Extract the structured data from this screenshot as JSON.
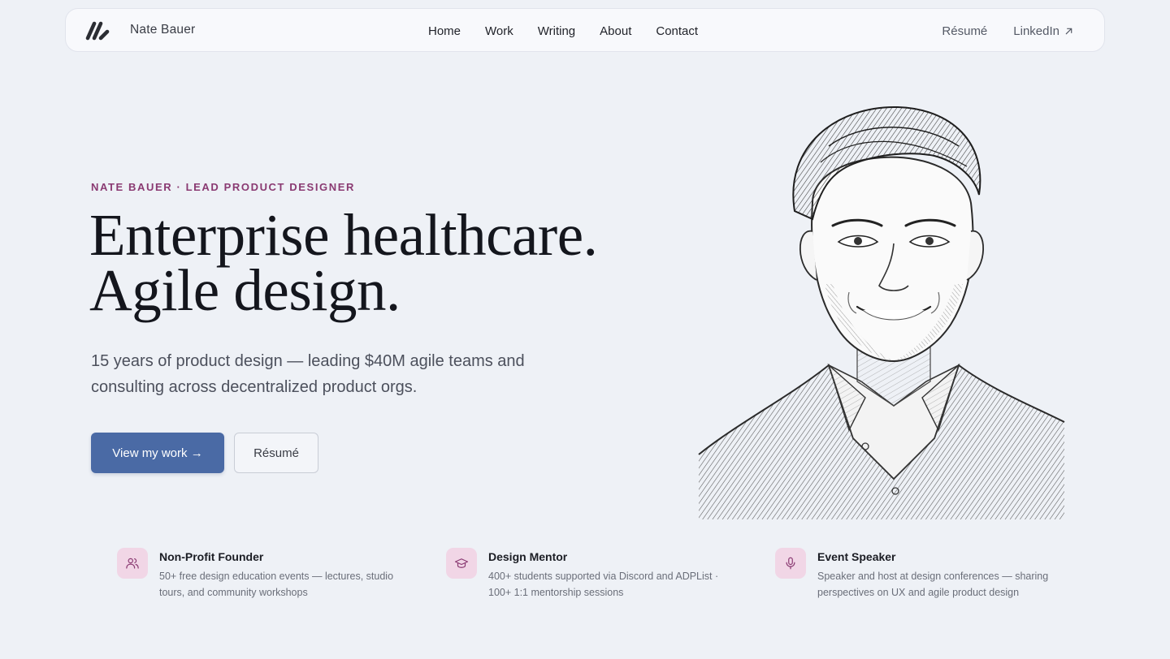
{
  "nav": {
    "brand_name": "Nate Bauer",
    "links": [
      "Home",
      "Work",
      "Writing",
      "About",
      "Contact"
    ],
    "resume": "Résumé",
    "linkedin": "LinkedIn"
  },
  "hero": {
    "eyebrow": "NATE BAUER · LEAD PRODUCT DESIGNER",
    "headline_line1": "Enterprise healthcare.",
    "headline_line2": "Agile design.",
    "lead": "15 years of product design — leading $40M agile teams and consulting across decentralized product orgs.",
    "primary_cta": "View my work →",
    "secondary_cta": "Résumé"
  },
  "features": [
    {
      "icon": "users-icon",
      "title": "Non-Profit Founder",
      "desc": "50+ free design education events — lectures, studio tours, and community workshops"
    },
    {
      "icon": "graduation-cap-icon",
      "title": "Design Mentor",
      "desc": "400+ students supported via Discord and ADPList · 100+ 1:1 mentorship sessions"
    },
    {
      "icon": "microphone-icon",
      "title": "Event Speaker",
      "desc": "Speaker and host at design conferences — sharing perspectives on UX and agile product design"
    }
  ],
  "colors": {
    "background": "#eef1f6",
    "accent": "#4a6aa5",
    "eyebrow": "#8a3a72",
    "icon_tile": "#f1d6e6"
  }
}
